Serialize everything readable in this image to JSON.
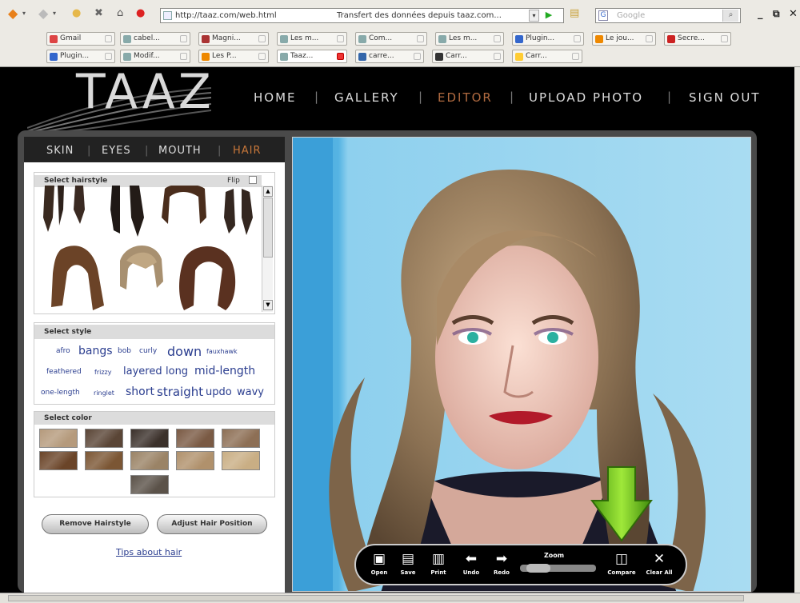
{
  "browser": {
    "url": "http://taaz.com/web.html",
    "page_title": "Transfert des données depuis taaz.com...",
    "search_placeholder": "Google",
    "bookmarks_row1": [
      {
        "label": "Gmail",
        "color": "#d44"
      },
      {
        "label": "cabel...",
        "color": "#8aa"
      },
      {
        "label": "Magni...",
        "color": "#a33"
      },
      {
        "label": "Les m...",
        "color": "#8aa"
      },
      {
        "label": "Com...",
        "color": "#8aa"
      },
      {
        "label": "Les m...",
        "color": "#8aa"
      },
      {
        "label": "Plugin...",
        "color": "#36c"
      },
      {
        "label": "Le jou...",
        "color": "#e80"
      },
      {
        "label": "Secre...",
        "color": "#c22"
      }
    ],
    "bookmarks_row2": [
      {
        "label": "Plugin...",
        "color": "#36c"
      },
      {
        "label": "Modif...",
        "color": "#8aa"
      },
      {
        "label": "Les P...",
        "color": "#e80"
      },
      {
        "label": "Taaz...",
        "color": "#8aa"
      },
      {
        "label": "carre...",
        "color": "#36a"
      },
      {
        "label": "Carr...",
        "color": "#333"
      },
      {
        "label": "Carr...",
        "color": "#fc3"
      }
    ]
  },
  "site": {
    "logo": "TAAZ",
    "nav": [
      {
        "label": "HOME"
      },
      {
        "label": "GALLERY"
      },
      {
        "label": "EDITOR"
      },
      {
        "label": "UPLOAD PHOTO"
      },
      {
        "label": "SIGN OUT"
      }
    ],
    "active_nav": "EDITOR",
    "accent_color": "#b06a40"
  },
  "editor": {
    "subtabs": [
      "SKIN",
      "EYES",
      "MOUTH",
      "HAIR"
    ],
    "active_subtab": "HAIR",
    "select_hairstyle_label": "Select hairstyle",
    "flip_label": "Flip",
    "select_style_label": "Select style",
    "styles": [
      "afro",
      "bangs",
      "bob",
      "curly",
      "down",
      "fauxhawk",
      "feathered",
      "frizzy",
      "layered",
      "long",
      "mid-length",
      "one-length",
      "ringlet",
      "short",
      "straight",
      "updo",
      "wavy"
    ],
    "select_color_label": "Select color",
    "hair_colors": [
      "#b59a7c",
      "#5a4536",
      "#3b312b",
      "#7a5a44",
      "#8d6f55",
      "#6a4428",
      "#7b5634",
      "#9a8366",
      "#b0916c",
      "#c9ae84",
      "#5b5249"
    ],
    "remove_button": "Remove Hairstyle",
    "adjust_button": "Adjust Hair Position",
    "tips_link": "Tips about hair"
  },
  "canvas_tools": [
    {
      "label": "Open",
      "icon": "open-icon"
    },
    {
      "label": "Save",
      "icon": "save-icon"
    },
    {
      "label": "Print",
      "icon": "print-icon"
    },
    {
      "label": "Undo",
      "icon": "undo-arrow-icon"
    },
    {
      "label": "Redo",
      "icon": "redo-arrow-icon"
    },
    {
      "label": "Compare",
      "icon": "compare-icon"
    },
    {
      "label": "Clear All",
      "icon": "clear-x-icon"
    }
  ],
  "zoom_label": "Zoom"
}
